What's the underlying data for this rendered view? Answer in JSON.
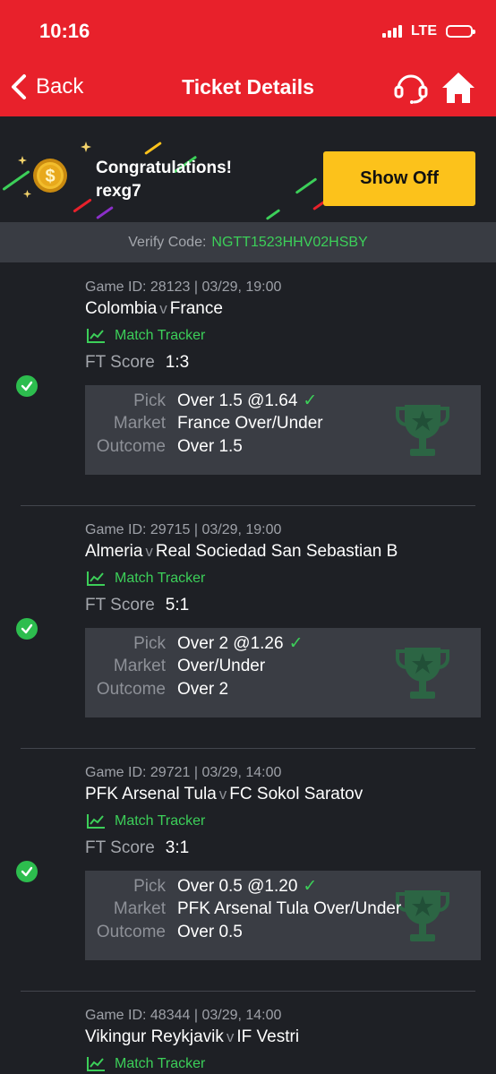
{
  "status_bar": {
    "time": "10:16",
    "network": "LTE"
  },
  "nav": {
    "back_label": "Back",
    "title": "Ticket Details"
  },
  "banner": {
    "congrats": "Congratulations!",
    "username": "rexg7",
    "show_off_label": "Show Off"
  },
  "verify": {
    "label": "Verify Code:",
    "code": "NGTT1523HHV02HSBY"
  },
  "colors": {
    "brand_red": "#e8212b",
    "win_green": "#3ccf59",
    "cta_yellow": "#fcc21b",
    "background": "#1e2025"
  },
  "tickets": [
    {
      "meta": "Game ID: 28123 | 03/29, 19:00",
      "home": "Colombia",
      "vs": "v",
      "away": "France",
      "tracker_label": "Match Tracker",
      "score_label": "FT Score",
      "score": "1:3",
      "pick_label": "Pick",
      "pick": "Over 1.5 @1.64",
      "market_label": "Market",
      "market": "France Over/Under",
      "outcome_label": "Outcome",
      "outcome": "Over 1.5"
    },
    {
      "meta": "Game ID: 29715 | 03/29, 19:00",
      "home": "Almeria",
      "vs": "v",
      "away": "Real Sociedad San Sebastian B",
      "tracker_label": "Match Tracker",
      "score_label": "FT Score",
      "score": "5:1",
      "pick_label": "Pick",
      "pick": "Over 2 @1.26",
      "market_label": "Market",
      "market": "Over/Under",
      "outcome_label": "Outcome",
      "outcome": "Over 2"
    },
    {
      "meta": "Game ID: 29721 | 03/29, 14:00",
      "home": "PFK Arsenal Tula",
      "vs": "v",
      "away": "FC Sokol Saratov",
      "tracker_label": "Match Tracker",
      "score_label": "FT Score",
      "score": "3:1",
      "pick_label": "Pick",
      "pick": "Over 0.5 @1.20",
      "market_label": "Market",
      "market": "PFK Arsenal Tula Over/Under",
      "outcome_label": "Outcome",
      "outcome": "Over 0.5"
    },
    {
      "meta": "Game ID: 48344 | 03/29, 14:00",
      "home": "Vikingur Reykjavik",
      "vs": "v",
      "away": "IF Vestri",
      "tracker_label": "Match Tracker"
    }
  ]
}
